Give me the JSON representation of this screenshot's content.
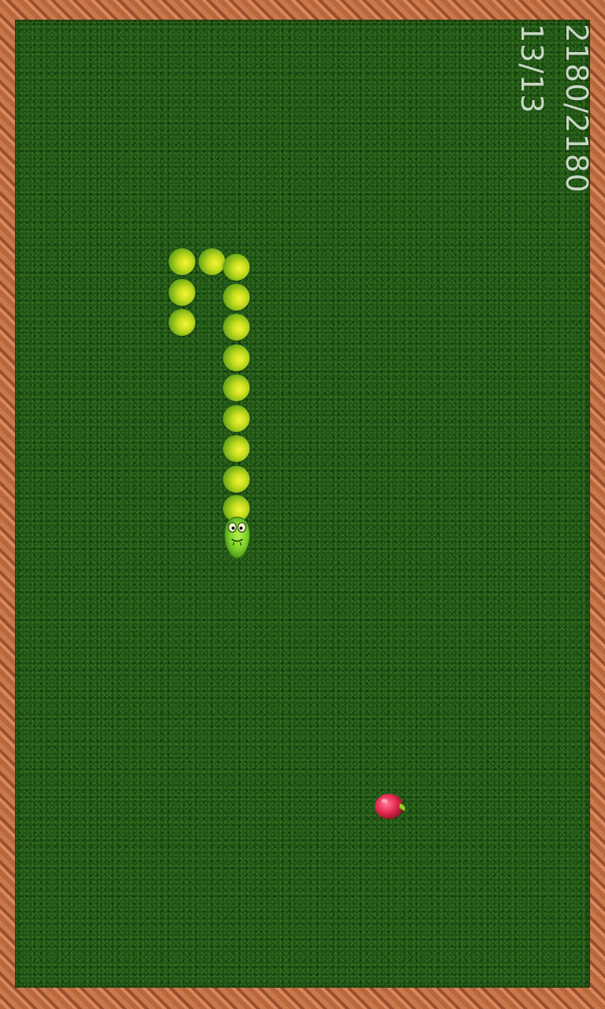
{
  "hud": {
    "score": "2180/2180",
    "length": "13/13"
  },
  "colors": {
    "grass": "#1f5416",
    "border": "#b9663d",
    "snake_body": "#c9de1e",
    "snake_head": "#7fd12b",
    "apple": "#e5294f",
    "hud_text": "#c8d8c4"
  },
  "snake": {
    "direction": "down",
    "segment_count": 13
  },
  "icons": {
    "head": "snake-head-icon",
    "body": "snake-segment-icon",
    "food": "apple-icon"
  }
}
